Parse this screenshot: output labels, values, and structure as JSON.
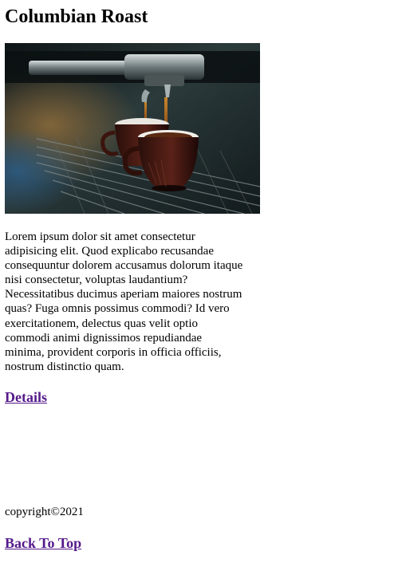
{
  "page": {
    "title": "Columbian Roast",
    "hero_image": {
      "alt": "espresso machine pouring into two brown cups"
    },
    "description": "Lorem ipsum dolor sit amet consectetur adipisicing elit. Quod explicabo recusandae consequuntur dolorem accusamus dolorum itaque nisi consectetur, voluptas laudantium? Necessitatibus ducimus aperiam maiores nostrum quas? Fuga omnis possimus commodi? Id vero exercitationem, delectus quas velit optio commodi animi dignissimos repudiandae minima, provident corporis in officia officiis, nostrum distinctio quam.",
    "details_link": "Details"
  },
  "footer": {
    "copyright": "copyright©2021",
    "back_to_top_link": "Back To Top"
  },
  "colors": {
    "link_visited": "#551a8b",
    "text": "#000000",
    "background": "#ffffff"
  }
}
